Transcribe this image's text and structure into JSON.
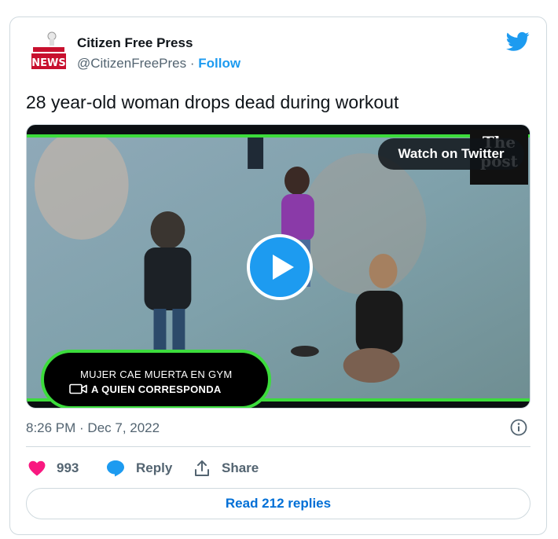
{
  "author": {
    "name": "Citizen Free Press",
    "handle": "@CitizenFreePres",
    "separator": "·",
    "follow_label": "Follow",
    "avatar_text": "NEWS"
  },
  "tweet": {
    "text": "28 year-old woman drops dead during workout"
  },
  "media": {
    "watch_label": "Watch on Twitter",
    "logo_line1": "The",
    "logo_line2": "post",
    "caption_line1": "MUJER CAE MUERTA EN GYM",
    "caption_line2": "A QUIEN CORRESPONDA",
    "accent_color": "#3cdc3c"
  },
  "meta": {
    "timestamp": "8:26 PM · Dec 7, 2022"
  },
  "actions": {
    "like_count": "993",
    "reply_label": "Reply",
    "share_label": "Share",
    "read_replies_label": "Read 212 replies"
  },
  "icons": {
    "brand": "twitter-bird-icon",
    "like": "heart-icon",
    "reply": "speech-bubble-icon",
    "share": "share-upload-icon",
    "info": "info-icon",
    "play": "play-icon",
    "camera": "video-camera-icon"
  },
  "colors": {
    "twitter_blue": "#1d9bf0",
    "like_pink": "#f91880",
    "link_blue": "#006fd6",
    "muted": "#536471",
    "border": "#cfd9de"
  }
}
